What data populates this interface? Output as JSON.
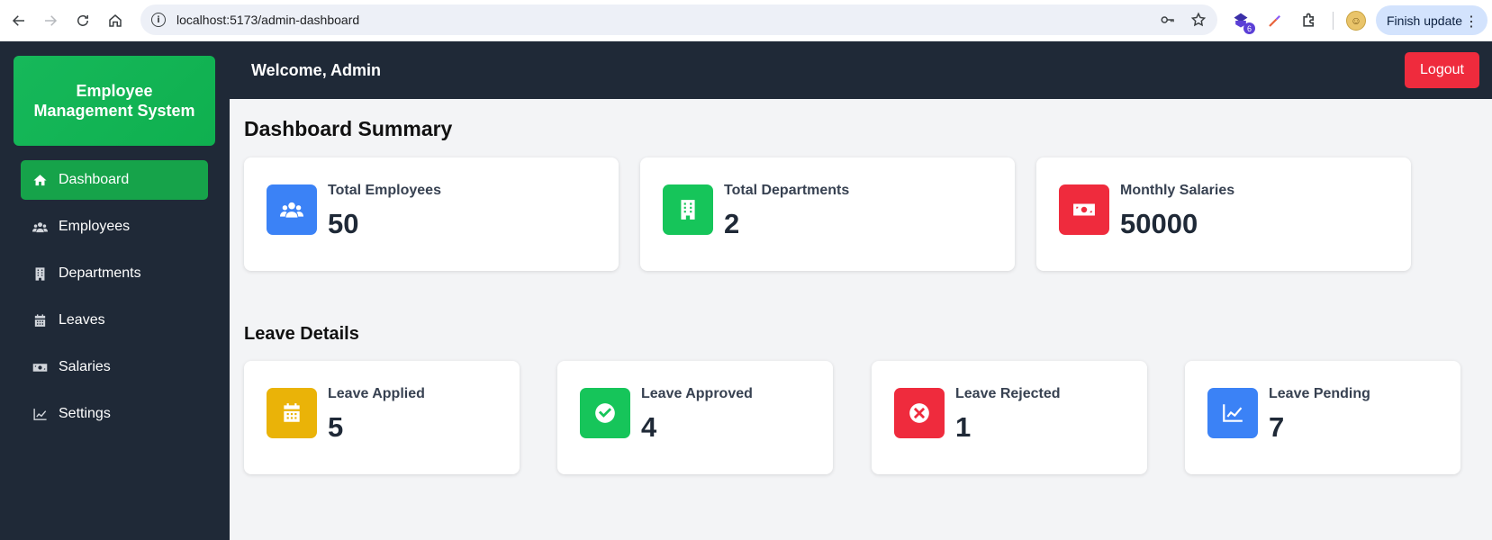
{
  "browser": {
    "url": "localhost:5173/admin-dashboard",
    "extension_badge": "6",
    "finish_update_label": "Finish update"
  },
  "sidebar": {
    "brand": "Employee Management System",
    "items": [
      {
        "label": "Dashboard",
        "icon": "home-icon",
        "active": true
      },
      {
        "label": "Employees",
        "icon": "users-icon",
        "active": false
      },
      {
        "label": "Departments",
        "icon": "building-icon",
        "active": false
      },
      {
        "label": "Leaves",
        "icon": "calendar-icon",
        "active": false
      },
      {
        "label": "Salaries",
        "icon": "money-bill-icon",
        "active": false
      },
      {
        "label": "Settings",
        "icon": "chart-line-icon",
        "active": false
      }
    ]
  },
  "header": {
    "welcome": "Welcome, Admin",
    "logout_label": "Logout"
  },
  "summary": {
    "title": "Dashboard Summary",
    "cards": [
      {
        "label": "Total Employees",
        "value": "50",
        "icon": "users-icon",
        "color": "#3b82f6"
      },
      {
        "label": "Total Departments",
        "value": "2",
        "icon": "building-icon",
        "color": "#16c55a"
      },
      {
        "label": "Monthly Salaries",
        "value": "50000",
        "icon": "money-bill-icon",
        "color": "#ef2b3d"
      }
    ]
  },
  "leaves": {
    "title": "Leave Details",
    "cards": [
      {
        "label": "Leave Applied",
        "value": "5",
        "icon": "calendar-icon",
        "color": "#eab308"
      },
      {
        "label": "Leave Approved",
        "value": "4",
        "icon": "check-circle-icon",
        "color": "#16c55a"
      },
      {
        "label": "Leave Rejected",
        "value": "1",
        "icon": "times-circle-icon",
        "color": "#ef2b3d"
      },
      {
        "label": "Leave Pending",
        "value": "7",
        "icon": "chart-line-icon",
        "color": "#3b82f6"
      }
    ]
  }
}
